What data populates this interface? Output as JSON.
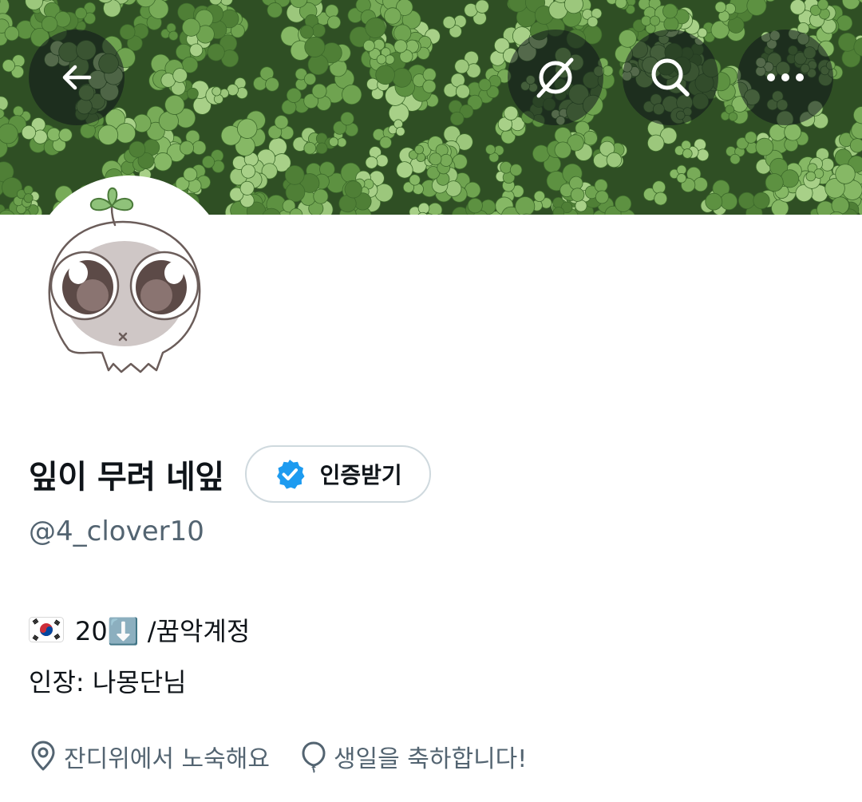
{
  "profile": {
    "display_name": "잎이 무려 네잎",
    "verify_label": "인증받기",
    "handle": "@4_clover10",
    "bio_line1": "20⬇️ /꿈악계정",
    "bio_line2": "인장: 나몽단님",
    "location": "잔디위에서 노숙해요",
    "birthday": "생일을 축하합니다!"
  },
  "icons": {
    "back": "arrow-left-icon",
    "grok": "grok-icon",
    "search": "search-icon",
    "more": "more-horizontal-icon",
    "verified": "verified-badge-icon",
    "flag": "south-korea-flag-icon",
    "location": "location-pin-icon",
    "birthday": "balloon-icon"
  },
  "colors": {
    "verified_blue": "#1d9bf0",
    "secondary_text": "#536471",
    "border": "#cfd9de"
  }
}
